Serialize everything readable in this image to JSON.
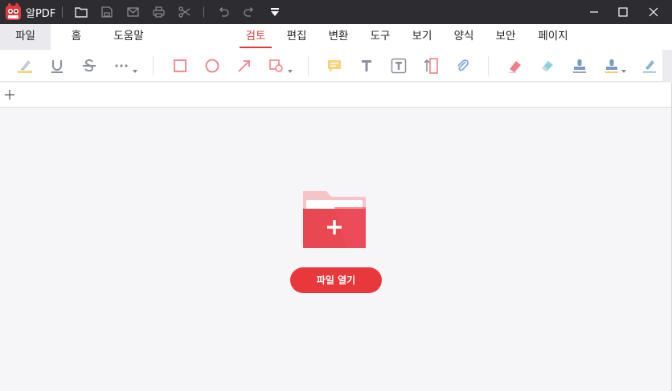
{
  "titlebar": {
    "app_title": "알PDF",
    "quick_icons": [
      "folder-open-icon",
      "save-icon",
      "mail-icon",
      "print-icon",
      "scissors-icon",
      "undo-icon",
      "redo-icon",
      "customize-quick-access-icon"
    ],
    "window_buttons": [
      "minimize-icon",
      "maximize-icon",
      "close-icon"
    ]
  },
  "menubar": {
    "file": "파일",
    "items": [
      "홈",
      "도움말",
      "검토",
      "편집",
      "변환",
      "도구",
      "보기",
      "양식",
      "보안",
      "페이지"
    ],
    "active": "검토"
  },
  "toolbar": {
    "tools": [
      "highlighter-icon",
      "underline-icon",
      "strikethrough-icon",
      "more-text-markup-icon",
      "rectangle-icon",
      "ellipse-icon",
      "arrow-icon",
      "shape-more-icon",
      "sticky-note-icon",
      "typewriter-text-icon",
      "textbox-icon",
      "callout-icon",
      "attachment-icon",
      "eraser-red-icon",
      "eraser-blue-icon",
      "stamp-icon",
      "stamp-more-icon",
      "signature-pen-icon"
    ]
  },
  "tabrow": {
    "add_tab_icon": "plus-icon"
  },
  "main": {
    "folder_icon": "add-folder-icon",
    "open_button": "파일 열기"
  },
  "colors": {
    "accent": "#e8383c",
    "titlebar": "#2d2d31",
    "background": "#f6f6f9"
  }
}
